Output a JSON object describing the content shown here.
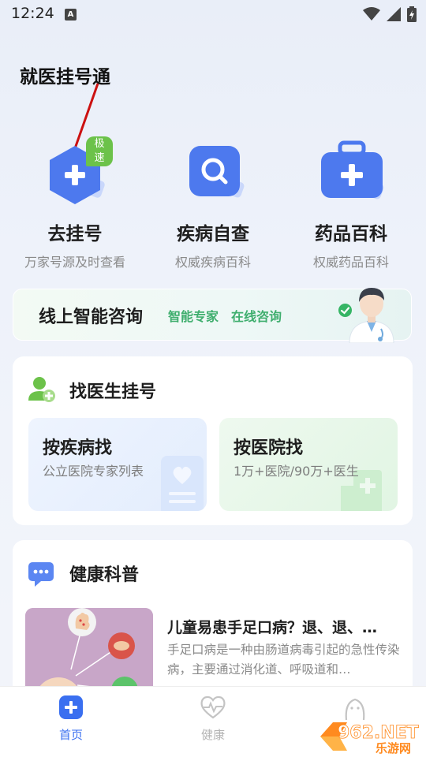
{
  "status_bar": {
    "time": "12:24",
    "notif_letter": "A"
  },
  "annotation": {
    "text": "就医挂号通"
  },
  "services": [
    {
      "title": "去挂号",
      "subtitle": "万家号源及时查看",
      "badge": "极速",
      "icon": "hospital-plus-icon"
    },
    {
      "title": "疾病自查",
      "subtitle": "权威疾病百科",
      "icon": "search-icon"
    },
    {
      "title": "药品百科",
      "subtitle": "权威药品百科",
      "icon": "medicine-kit-icon"
    }
  ],
  "consult": {
    "title": "线上智能咨询",
    "tags": [
      "智能专家",
      "在线咨询"
    ]
  },
  "find_doctor": {
    "title": "找医生挂号",
    "tiles": [
      {
        "title": "按疾病找",
        "subtitle": "公立医院专家列表"
      },
      {
        "title": "按医院找",
        "subtitle": "1万+医院/90万+医生"
      }
    ]
  },
  "health_science": {
    "title": "健康科普",
    "article": {
      "title": "儿童易患手足口病？退、退、…",
      "excerpt": "手足口病是一种由肠道病毒引起的急性传染病，主要通过消化道、呼吸道和…"
    }
  },
  "bottom_nav": [
    {
      "label": "首页",
      "active": true
    },
    {
      "label": "健康",
      "active": false
    },
    {
      "label": "",
      "active": false
    }
  ],
  "watermark": {
    "logo": "962.NET",
    "text": "乐游网"
  },
  "colors": {
    "accent": "#3a6ff0",
    "green": "#3fae6e",
    "badge": "#6cc24a",
    "annotation_arrow": "#cc1111"
  }
}
